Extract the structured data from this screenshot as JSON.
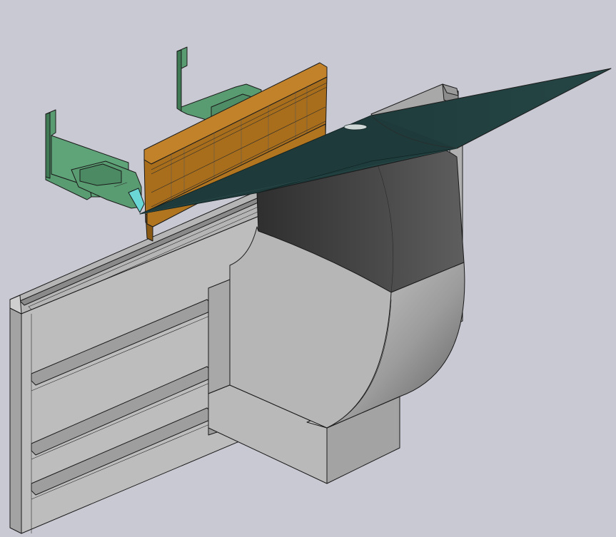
{
  "viewport": {
    "background": "#c9c9d3"
  },
  "colors": {
    "rail_light": "#c4c4c4",
    "rail_mid": "#a8a8a8",
    "rail_dark": "#8c8c8c",
    "block_light": "#b8b8b8",
    "block_dark": "#9a9a9a",
    "die_dark": "#3c3c3c",
    "die_mid": "#5a5a5a",
    "punch": "#a86e1c",
    "punch_dark": "#8a5a14",
    "bracket": "#5a9c72",
    "bracket_dark": "#3f7a55",
    "sheet": "#1f3a3a",
    "sheet_dark": "#152a2a",
    "finger": "#6ad6d6"
  }
}
